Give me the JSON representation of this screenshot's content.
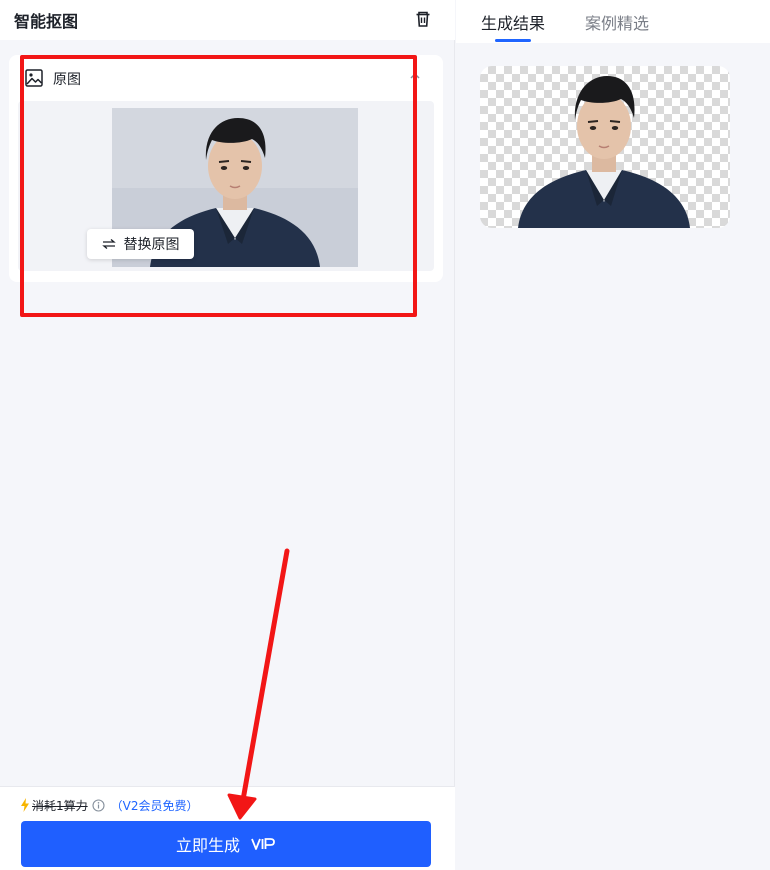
{
  "left_panel": {
    "title": "智能抠图",
    "trash_icon": "trash-icon",
    "card": {
      "title": "原图",
      "icon": "image-icon",
      "collapse_icon": "chevron-up-icon",
      "replace_button": {
        "label": "替换原图",
        "icon": "swap-icon"
      }
    }
  },
  "footer": {
    "cost_label": "消耗1算力",
    "bolt_icon": "lightning-icon",
    "info_icon": "info-icon",
    "vip_note": "（V2会员免费）",
    "generate_button": {
      "label": "立即生成",
      "badge": "VIP"
    }
  },
  "right_panel": {
    "tabs": [
      {
        "label": "生成结果",
        "active": true
      },
      {
        "label": "案例精选",
        "active": false
      }
    ]
  },
  "colors": {
    "accent": "#1f5fff",
    "annotation_red": "#f21616",
    "panel_bg": "#f5f6fa"
  }
}
